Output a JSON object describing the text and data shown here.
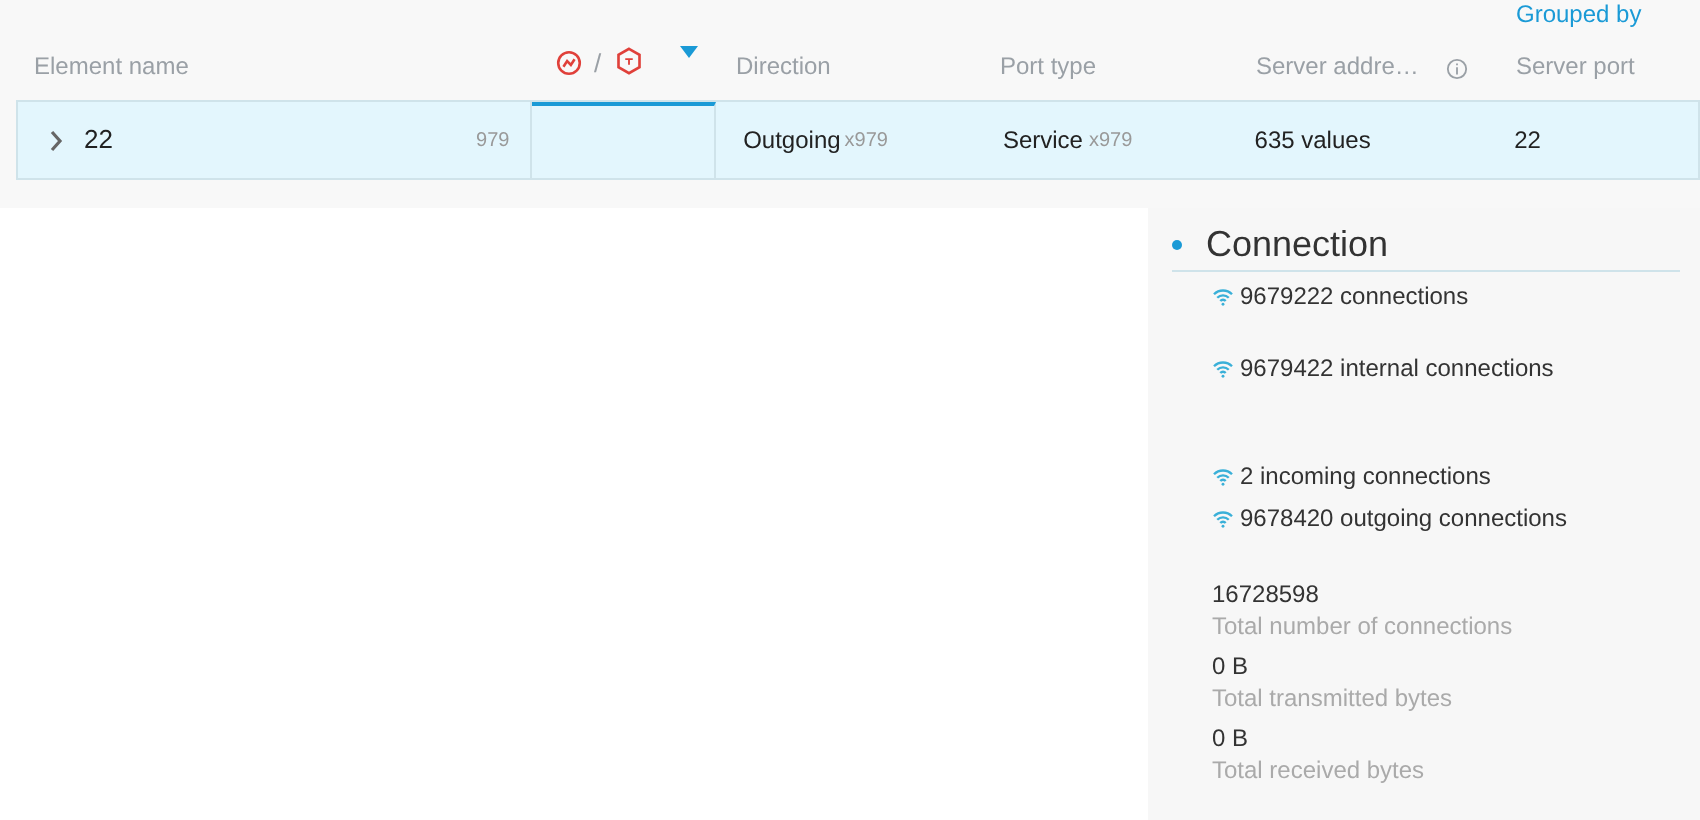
{
  "table": {
    "columns": [
      {
        "kind": "text",
        "label": "Element name"
      },
      {
        "kind": "icons",
        "separator": "/",
        "sorted": true
      },
      {
        "kind": "text",
        "label": "Direction"
      },
      {
        "kind": "text",
        "label": "Port type"
      },
      {
        "kind": "info",
        "label": "Server addre…"
      },
      {
        "kind": "grouped",
        "group_label": "Grouped by",
        "label": "Server port"
      }
    ],
    "rows": [
      {
        "expanded": false,
        "selected": true,
        "name": "22",
        "count": "979",
        "direction": "Outgoing",
        "direction_count": "x979",
        "port_type": "Service",
        "port_type_count": "x979",
        "server_address": "635 values",
        "server_port": "22"
      }
    ]
  },
  "panel": {
    "title": "Connection",
    "connection_groups": [
      [
        {
          "text": "9679222 connections"
        }
      ],
      [
        {
          "text": "9679422 internal connections"
        }
      ],
      [
        {
          "text": "2 incoming connections"
        },
        {
          "text": "9678420 outgoing connections"
        }
      ]
    ],
    "stats": [
      {
        "value": "16728598",
        "label": "Total number of connections"
      },
      {
        "value": "0 B",
        "label": "Total transmitted bytes"
      },
      {
        "value": "0 B",
        "label": "Total received bytes"
      }
    ]
  }
}
